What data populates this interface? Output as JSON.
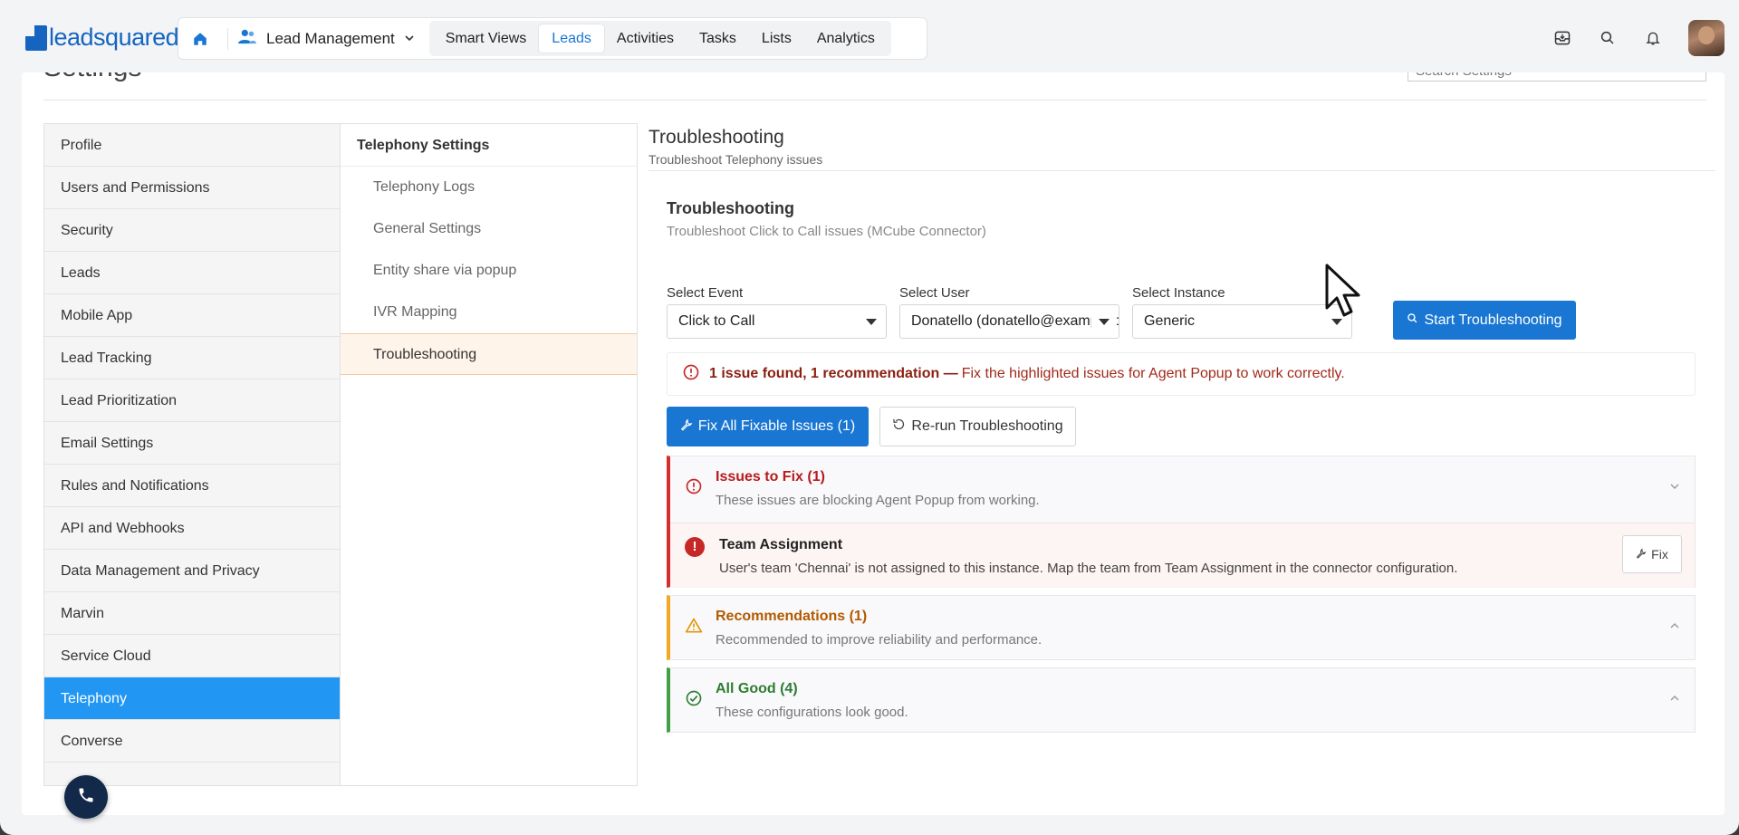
{
  "brand": {
    "logo_text": "leadsquared"
  },
  "nav": {
    "module": "Lead Management",
    "tabs": [
      {
        "label": "Smart Views",
        "active": false
      },
      {
        "label": "Leads",
        "active": true
      },
      {
        "label": "Activities",
        "active": false
      },
      {
        "label": "Tasks",
        "active": false
      },
      {
        "label": "Lists",
        "active": false
      },
      {
        "label": "Analytics",
        "active": false
      }
    ],
    "icons": [
      "inbox-icon",
      "search-icon",
      "bell-icon",
      "avatar"
    ]
  },
  "page": {
    "title": "Settings",
    "search_placeholder": "Search Settings"
  },
  "left_menu": [
    {
      "label": "Profile",
      "active": false
    },
    {
      "label": "Users and Permissions",
      "active": false
    },
    {
      "label": "Security",
      "active": false
    },
    {
      "label": "Leads",
      "active": false
    },
    {
      "label": "Mobile App",
      "active": false
    },
    {
      "label": "Lead Tracking",
      "active": false
    },
    {
      "label": "Lead Prioritization",
      "active": false
    },
    {
      "label": "Email Settings",
      "active": false
    },
    {
      "label": "Rules and Notifications",
      "active": false
    },
    {
      "label": "API and Webhooks",
      "active": false
    },
    {
      "label": "Data Management and Privacy",
      "active": false
    },
    {
      "label": "Marvin",
      "active": false
    },
    {
      "label": "Service Cloud",
      "active": false
    },
    {
      "label": "Telephony",
      "active": true
    },
    {
      "label": "Converse",
      "active": false
    }
  ],
  "sub_menu": {
    "heading": "Telephony Settings",
    "items": [
      {
        "label": "Telephony Logs",
        "active": false
      },
      {
        "label": "General Settings",
        "active": false
      },
      {
        "label": "Entity share via popup",
        "active": false
      },
      {
        "label": "IVR Mapping",
        "active": false
      },
      {
        "label": "Troubleshooting",
        "active": true
      }
    ]
  },
  "content": {
    "title": "Troubleshooting",
    "subtitle": "Troubleshoot Telephony issues",
    "panel": {
      "title": "Troubleshooting",
      "subtitle": "Troubleshoot Click to Call issues (MCube Connector)",
      "fields": {
        "event": {
          "label": "Select Event",
          "value": "Click to Call"
        },
        "user": {
          "label": "Select User",
          "value": "Donatello (donatello@example.com)"
        },
        "instance": {
          "label": "Select Instance",
          "value": "Generic"
        }
      },
      "start_button": "Start Troubleshooting",
      "alert": {
        "strong": "1 issue found, 1 recommendation —",
        "text": "Fix the highlighted issues for Agent Popup to work correctly."
      },
      "fix_all_button": "Fix All Fixable Issues (1)",
      "rerun_button": "Re-run Troubleshooting",
      "sections": {
        "issues": {
          "title": "Issues to Fix (1)",
          "subtitle": "These issues are blocking Agent Popup from working.",
          "items": [
            {
              "title": "Team Assignment",
              "description": "User's team 'Chennai' is not assigned to this instance. Map the team from Team Assignment in the connector configuration.",
              "button": "Fix"
            }
          ]
        },
        "recommendations": {
          "title": "Recommendations (1)",
          "subtitle": "Recommended to improve reliability and performance."
        },
        "good": {
          "title": "All Good (4)",
          "subtitle": "These configurations look good."
        }
      }
    }
  },
  "colors": {
    "brand": "#1565c0",
    "primary": "#1976d2",
    "active_menu": "#2196f3",
    "error": "#d32f2f",
    "warning": "#f5a623",
    "success": "#43a047"
  }
}
